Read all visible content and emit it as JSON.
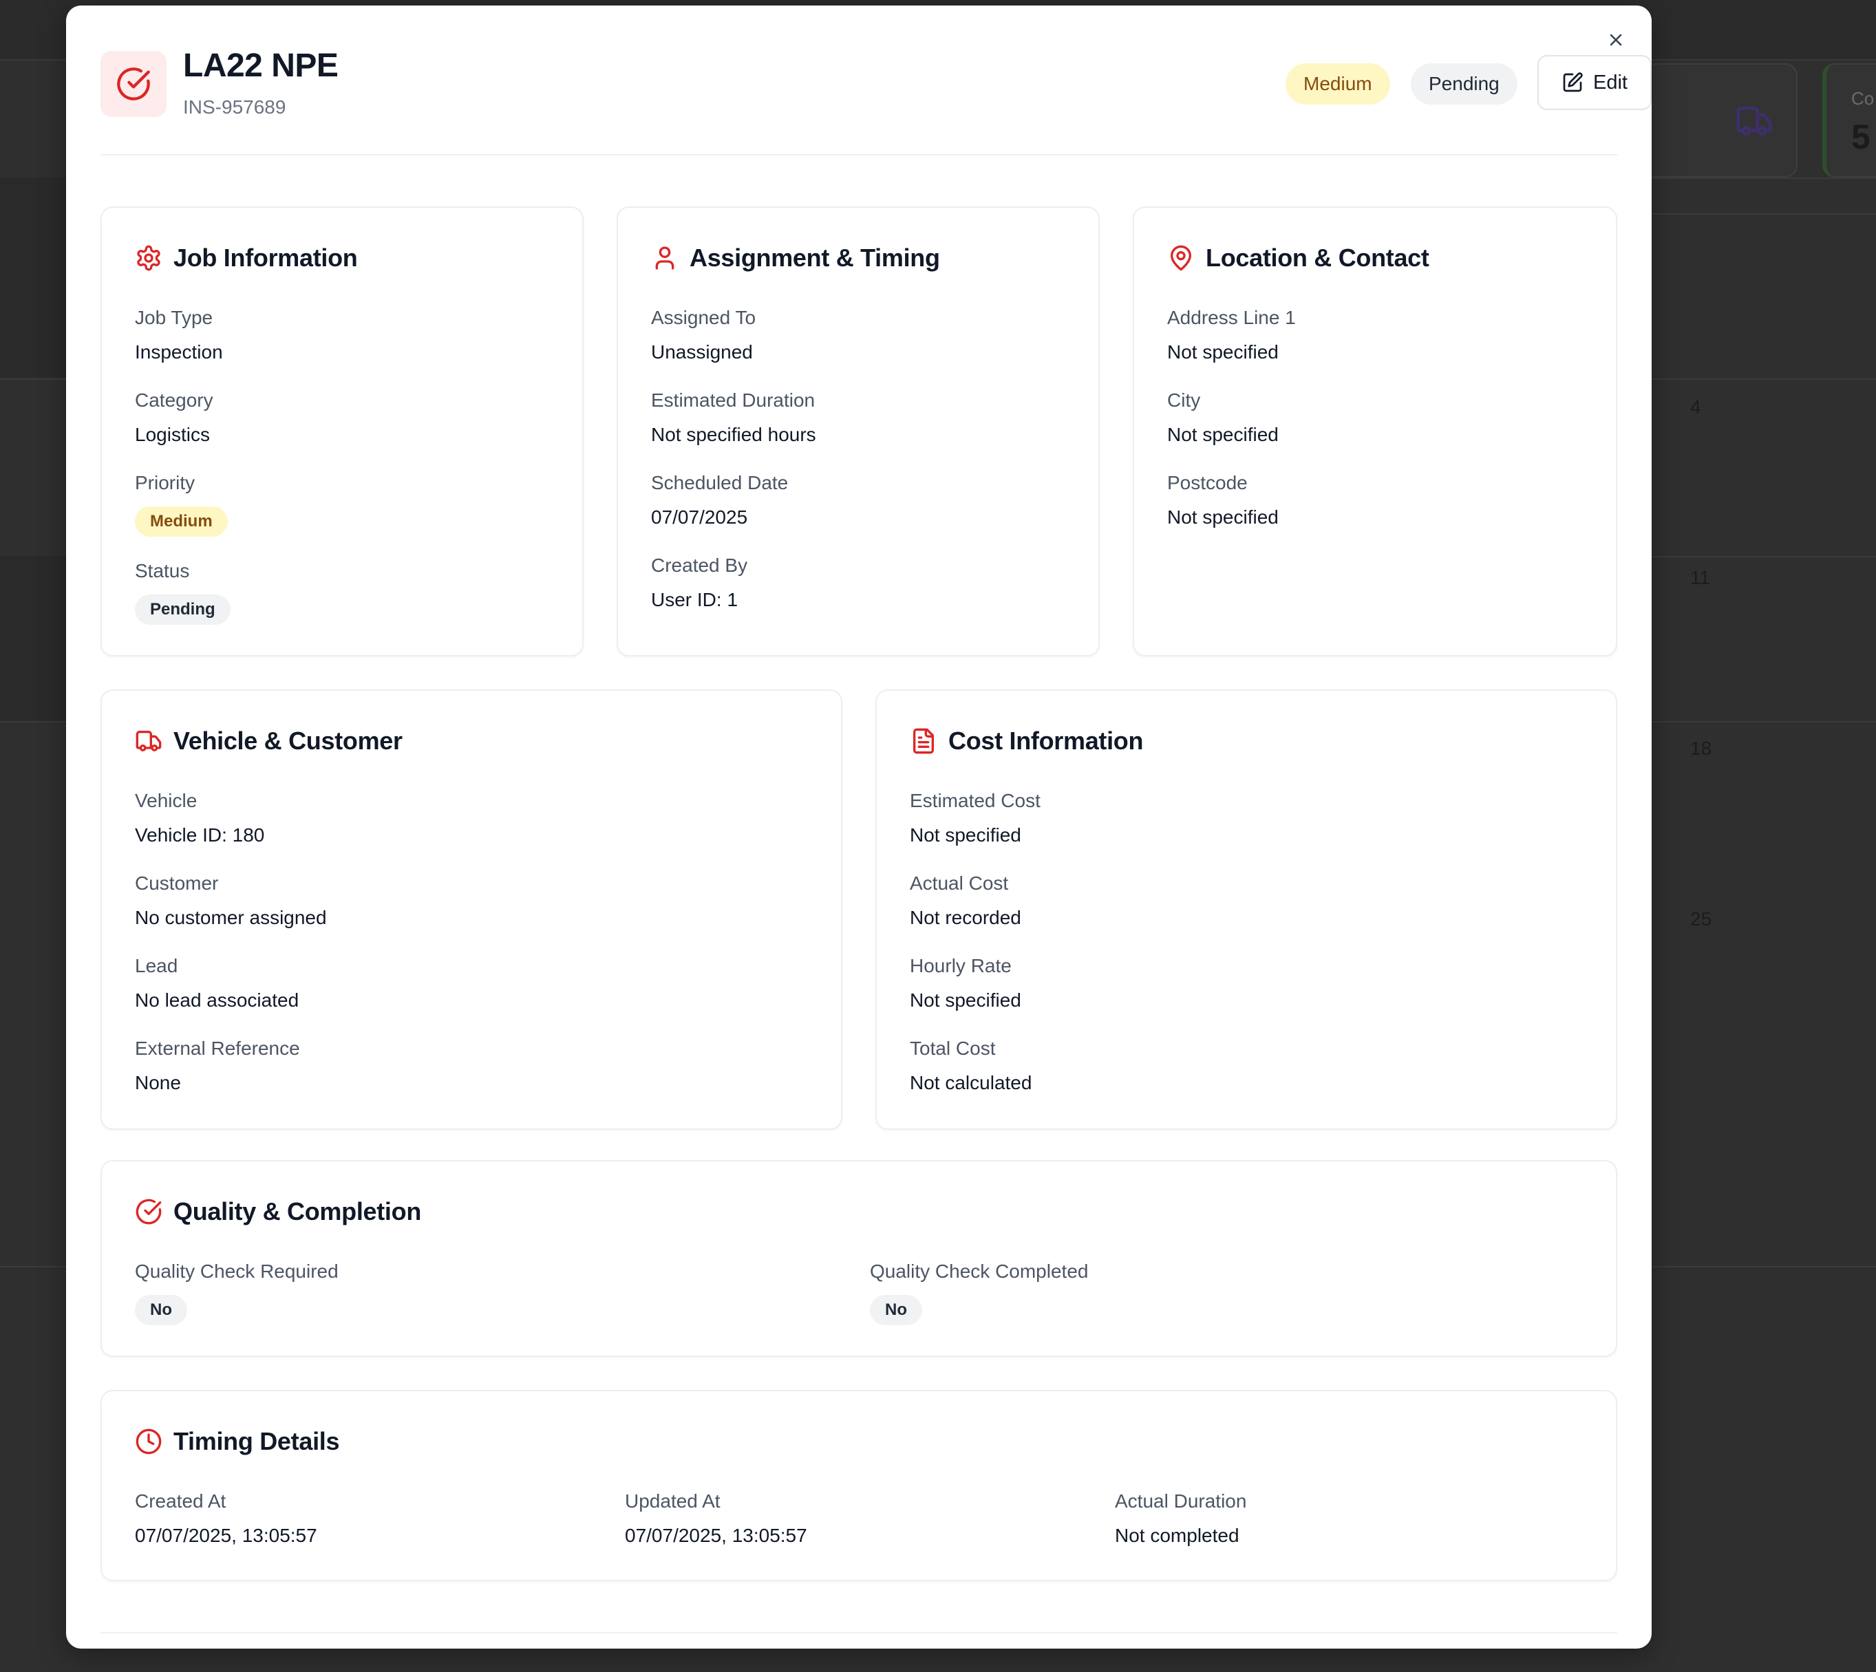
{
  "background": {
    "stat_card": {
      "label": "Co",
      "value": "5",
      "icon": "truck-icon"
    },
    "calendar_numbers": [
      "4",
      "11",
      "18",
      "25"
    ]
  },
  "modal": {
    "title": "LA22 NPE",
    "reference": "INS-957689",
    "header_icon": "check-circle-icon",
    "priority_badge": "Medium",
    "status_badge": "Pending",
    "edit_label": "Edit",
    "close_icon": "close-icon"
  },
  "job_information": {
    "title": "Job Information",
    "icon": "gear-icon",
    "fields": [
      {
        "label": "Job Type",
        "value": "Inspection"
      },
      {
        "label": "Category",
        "value": "Logistics"
      },
      {
        "label": "Priority",
        "value": "Medium"
      },
      {
        "label": "Status",
        "value": "Pending"
      }
    ]
  },
  "assignment_timing": {
    "title": "Assignment & Timing",
    "icon": "user-icon",
    "fields": [
      {
        "label": "Assigned To",
        "value": "Unassigned"
      },
      {
        "label": "Estimated Duration",
        "value": "Not specified hours"
      },
      {
        "label": "Scheduled Date",
        "value": "07/07/2025"
      },
      {
        "label": "Created By",
        "value": "User ID: 1"
      }
    ]
  },
  "location_contact": {
    "title": "Location & Contact",
    "icon": "map-pin-icon",
    "fields": [
      {
        "label": "Address Line 1",
        "value": "Not specified"
      },
      {
        "label": "City",
        "value": "Not specified"
      },
      {
        "label": "Postcode",
        "value": "Not specified"
      }
    ]
  },
  "vehicle_customer": {
    "title": "Vehicle & Customer",
    "icon": "truck-icon",
    "fields": [
      {
        "label": "Vehicle",
        "value": "Vehicle ID: 180"
      },
      {
        "label": "Customer",
        "value": "No customer assigned"
      },
      {
        "label": "Lead",
        "value": "No lead associated"
      },
      {
        "label": "External Reference",
        "value": "None"
      }
    ]
  },
  "cost_information": {
    "title": "Cost Information",
    "icon": "document-icon",
    "fields": [
      {
        "label": "Estimated Cost",
        "value": "Not specified"
      },
      {
        "label": "Actual Cost",
        "value": "Not recorded"
      },
      {
        "label": "Hourly Rate",
        "value": "Not specified"
      },
      {
        "label": "Total Cost",
        "value": "Not calculated"
      }
    ]
  },
  "quality_completion": {
    "title": "Quality & Completion",
    "icon": "check-circle-icon",
    "fields": [
      {
        "label": "Quality Check Required",
        "value": "No"
      },
      {
        "label": "Quality Check Completed",
        "value": "No"
      }
    ]
  },
  "timing_details": {
    "title": "Timing Details",
    "icon": "clock-icon",
    "fields": [
      {
        "label": "Created At",
        "value": "07/07/2025, 13:05:57"
      },
      {
        "label": "Updated At",
        "value": "07/07/2025, 13:05:57"
      },
      {
        "label": "Actual Duration",
        "value": "Not completed"
      }
    ]
  },
  "colors": {
    "accent_red": "#dc2626",
    "priority_bg": "#fef7c3",
    "priority_text": "#854d0e",
    "status_bg": "#f1f2f4"
  }
}
